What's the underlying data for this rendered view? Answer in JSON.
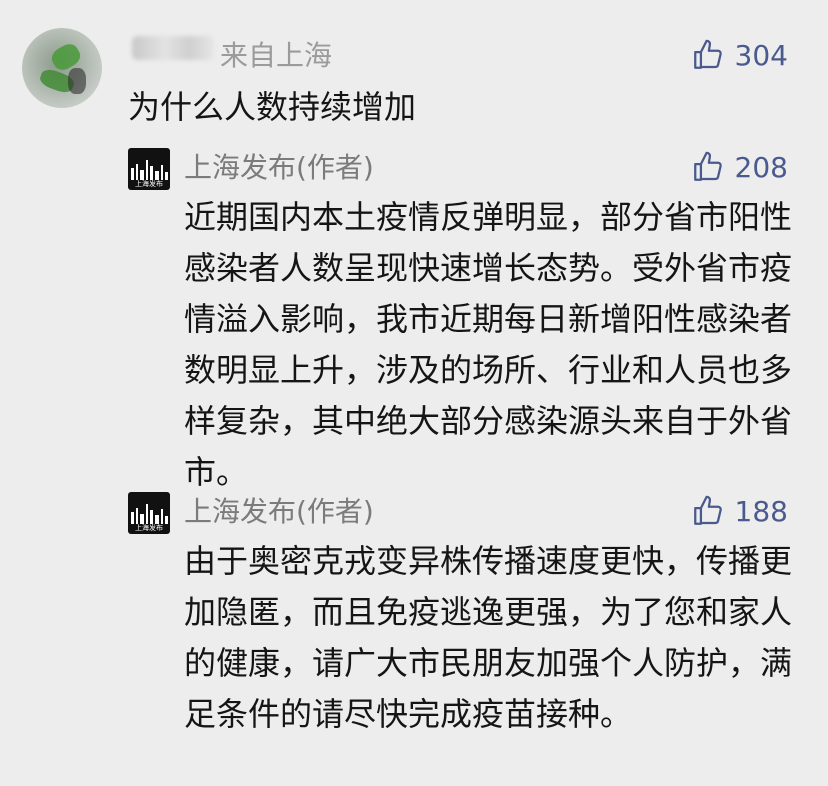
{
  "top_comment": {
    "location": "来自上海",
    "likes": "304",
    "text": "为什么人数持续增加"
  },
  "replies": [
    {
      "author": "上海发布(作者)",
      "avatar_caption": "上海发布",
      "likes": "208",
      "text": "近期国内本土疫情反弹明显，部分省市阳性感染者人数呈现快速增长态势。受外省市疫情溢入影响，我市近期每日新增阳性感染者数明显上升，涉及的场所、行业和人员也多样复杂，其中绝大部分感染源头来自于外省市。"
    },
    {
      "author": "上海发布(作者)",
      "avatar_caption": "上海发布",
      "likes": "188",
      "text": "由于奥密克戎变异株传播速度更快，传播更加隐匿，而且免疫逃逸更强，为了您和家人的健康，请广大市民朋友加强个人防护，满足条件的请尽快完成疫苗接种。"
    }
  ],
  "icons": {
    "like": "thumbs-up-icon"
  },
  "colors": {
    "like": "#4a5a8e",
    "meta": "#7b7b7b",
    "background": "#ededed"
  }
}
